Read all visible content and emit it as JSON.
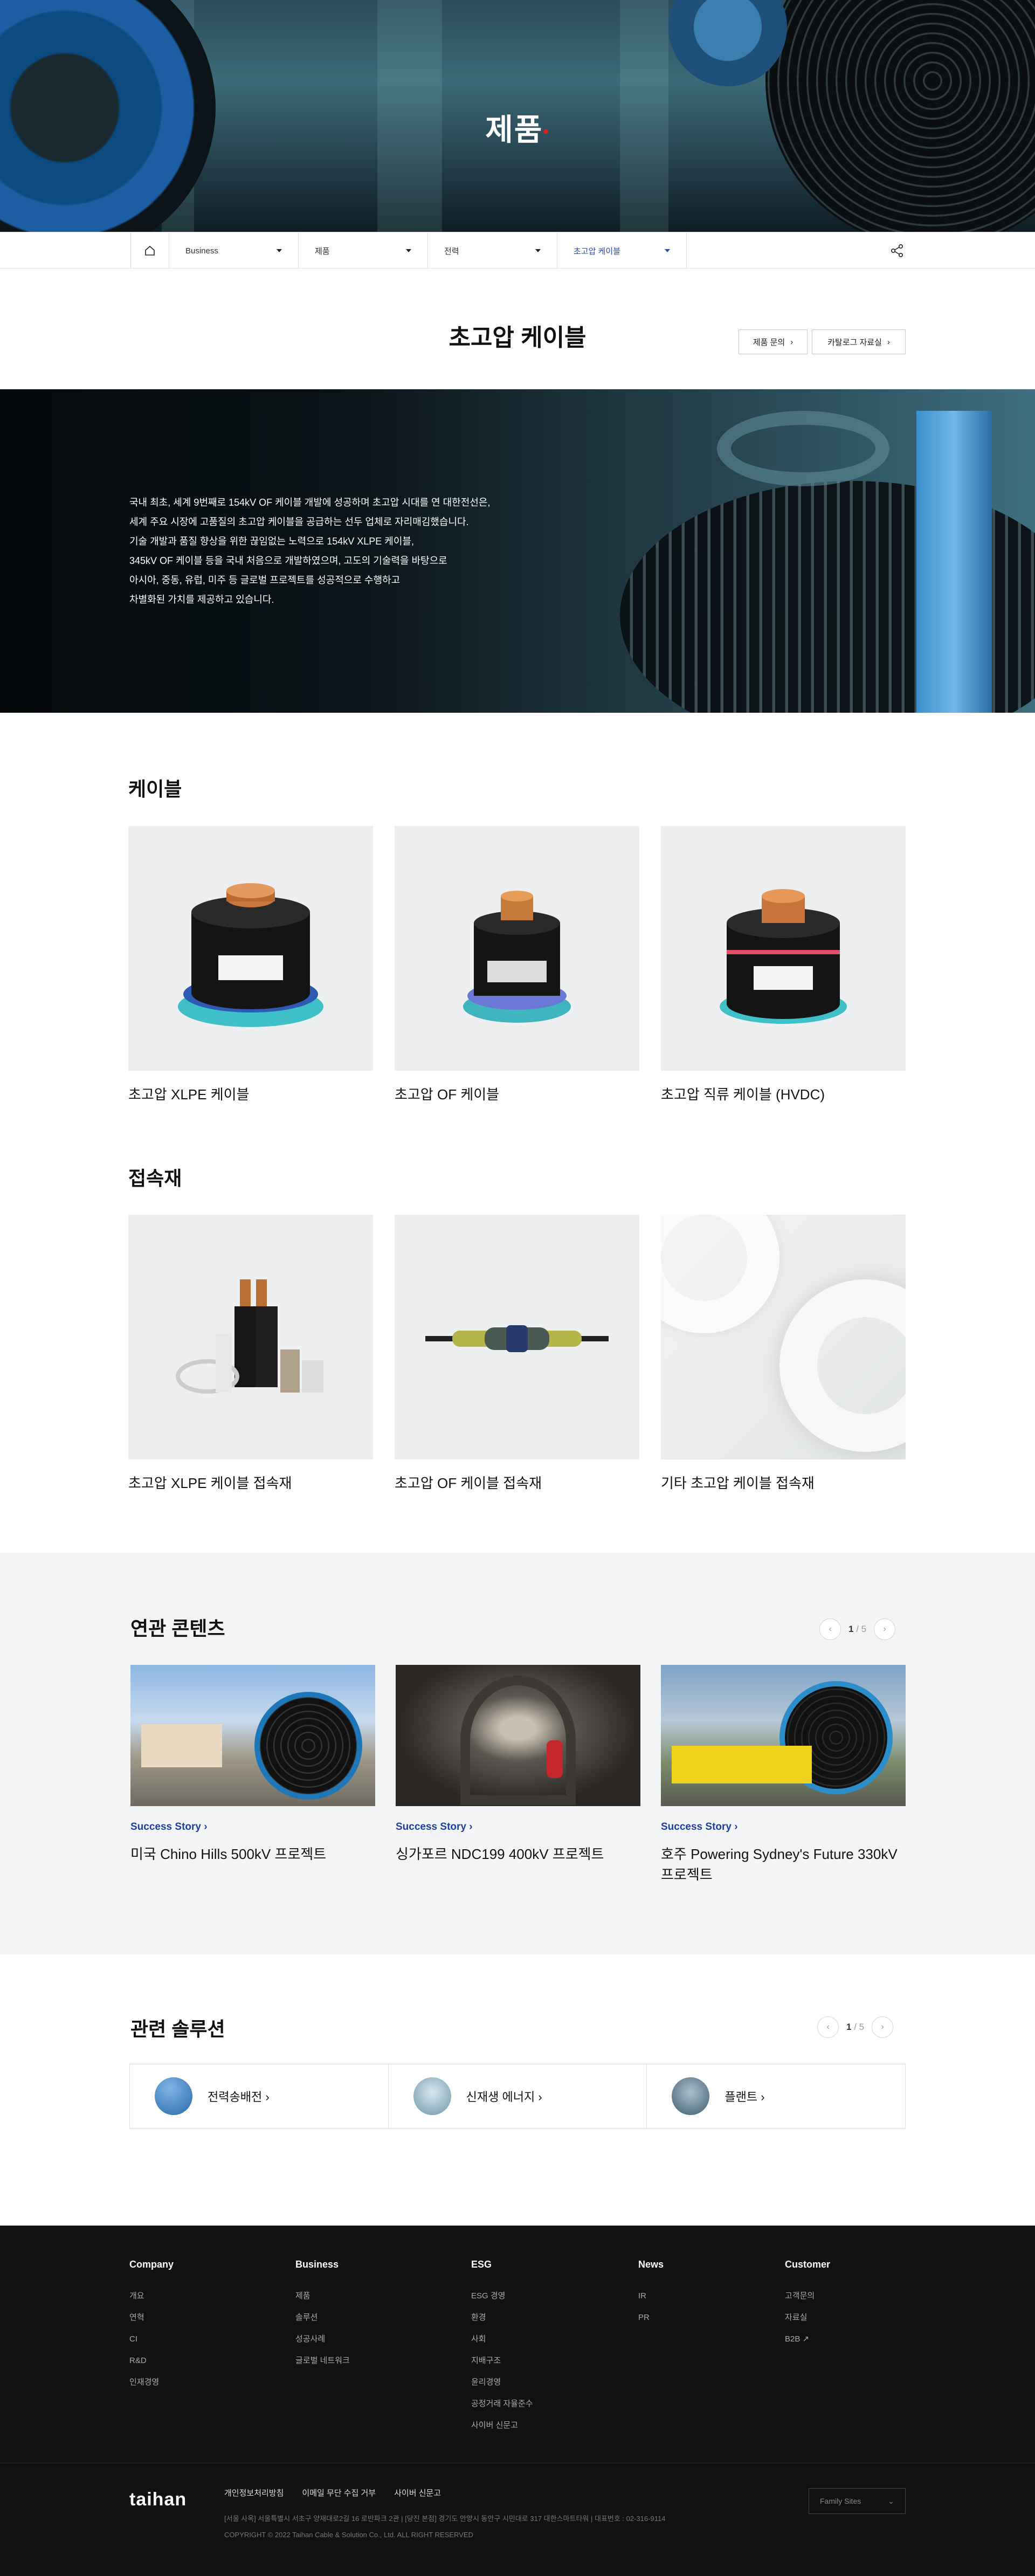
{
  "hero": {
    "title": "제품"
  },
  "subnav": {
    "items": [
      {
        "label": "Business"
      },
      {
        "label": "제품"
      },
      {
        "label": "전력"
      },
      {
        "label": "초고압 케이블"
      }
    ]
  },
  "page": {
    "title": "초고압 케이블",
    "buttons": [
      {
        "label": "제품 문의"
      },
      {
        "label": "카탈로그 자료실"
      }
    ]
  },
  "banner": {
    "lines": [
      "국내 최초, 세계 9번째로 154kV OF 케이블 개발에 성공하며 초고압 시대를 연 대한전선은,",
      "세계 주요 시장에 고품질의 초고압 케이블을 공급하는 선두 업체로 자리매김했습니다.",
      "기술 개발과 품질 향상을 위한 끊임없는 노력으로 154kV XLPE 케이블,",
      "345kV OF 케이블 등을 국내 처음으로 개발하였으며, 고도의 기술력을 바탕으로",
      "아시아, 중동, 유럽, 미주 등 글로벌 프로젝트를 성공적으로 수행하고",
      "차별화된 가치를 제공하고 있습니다."
    ]
  },
  "cables": {
    "title": "케이블",
    "items": [
      {
        "label": "초고압 XLPE 케이블"
      },
      {
        "label": "초고압 OF 케이블"
      },
      {
        "label": "초고압 직류 케이블 (HVDC)"
      }
    ]
  },
  "accessories": {
    "title": "접속재",
    "items": [
      {
        "label": "초고압 XLPE 케이블 접속재"
      },
      {
        "label": "초고압 OF 케이블 접속재"
      },
      {
        "label": "기타 초고압 케이블 접속재"
      }
    ]
  },
  "related": {
    "title": "연관 콘텐츠",
    "pager": {
      "current": "1",
      "total": "/ 5"
    },
    "items": [
      {
        "tag": "Success Story",
        "title": "미국 Chino Hills 500kV 프로젝트"
      },
      {
        "tag": "Success Story",
        "title": "싱가포르 NDC199 400kV 프로젝트"
      },
      {
        "tag": "Success Story",
        "title": "호주 Powering Sydney's Future 330kV 프로젝트"
      }
    ]
  },
  "solutions": {
    "title": "관련 솔루션",
    "pager": {
      "current": "1",
      "total": "/ 5"
    },
    "items": [
      {
        "label": "전력송배전"
      },
      {
        "label": "신재생 에너지"
      },
      {
        "label": "플랜트"
      }
    ]
  },
  "footer": {
    "columns": [
      {
        "title": "Company",
        "links": [
          "개요",
          "연혁",
          "CI",
          "R&D",
          "인재경영"
        ]
      },
      {
        "title": "Business",
        "links": [
          "제품",
          "솔루션",
          "성공사례",
          "글로벌 네트워크"
        ]
      },
      {
        "title": "ESG",
        "links": [
          "ESG 경영",
          "환경",
          "사회",
          "지배구조",
          "윤리경영",
          "공정거래 자율준수",
          "사이버 신문고"
        ]
      },
      {
        "title": "News",
        "links": [
          "IR",
          "PR"
        ]
      },
      {
        "title": "Customer",
        "links": [
          "고객문의",
          "자료실",
          "B2B"
        ]
      }
    ],
    "logo": "taihan",
    "policy_links": [
      "개인정보처리방침",
      "이메일 무단 수집 거부",
      "사이버 신문고"
    ],
    "address": "[서울 사옥] 서울특별시 서초구 양재대로2길 16 로반파크 2관 | [당진 본점] 경기도 안양시 동안구 시민대로 317 대한스마트타워 | 대표번호 : 02-316-9114",
    "copyright": "COPYRIGHT © 2022 Taihan Cable & Solution Co., Ltd. ALL RIGHT RESERVED",
    "family_sites": "Family Sites"
  }
}
